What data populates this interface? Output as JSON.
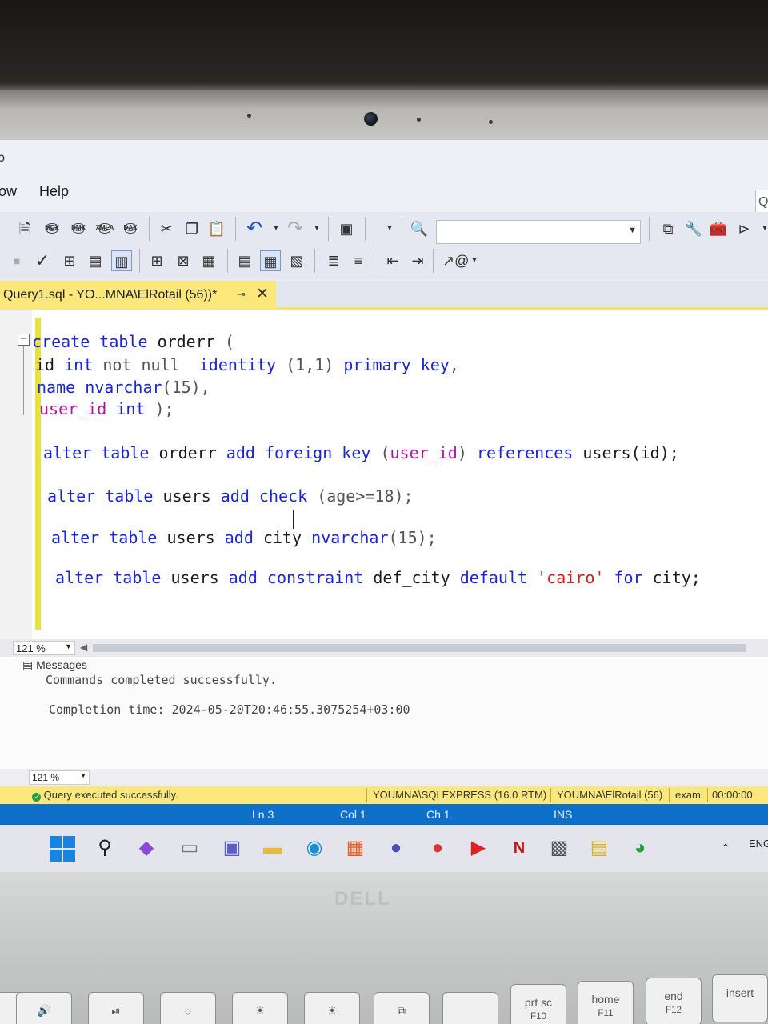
{
  "menu": {
    "partial_left": "ow",
    "help": "Help",
    "partial_top": "ɔ"
  },
  "toolbar1": {
    "icons": [
      "new-query-icon",
      "mdx-icon",
      "dmx-icon",
      "xmla-icon",
      "dax-icon",
      "cut-icon",
      "copy-icon",
      "paste-icon",
      "undo-icon",
      "redo-icon",
      "save-icon",
      "find-icon"
    ],
    "mdx": "MDX",
    "dmx": "DMX",
    "xmla": "XMLA",
    "dax": "DAX",
    "database_value": ""
  },
  "tab": {
    "title": "Query1.sql - YO...MNA\\ElRotail (56))*",
    "pin": "⊸",
    "close": "✕"
  },
  "code": {
    "l1_kw1": "create",
    "l1_kw2": "table",
    "l1_name": "orderr",
    "l1_paren": "(",
    "l2_a": "id",
    "l2_b": "int",
    "l2_c": "not null",
    "l2_d": "identity",
    "l2_e": "(1,1)",
    "l2_f": "primary key",
    "l2_g": ",",
    "l3_a": "name",
    "l3_b": "nvarchar",
    "l3_c": "(15),",
    "l4_a": "user_id",
    "l4_b": "int",
    "l4_c": ");",
    "l5_a": "alter table",
    "l5_b": "orderr",
    "l5_c": "add foreign key",
    "l5_d": "(",
    "l5_e": "user_id",
    "l5_f": ")",
    "l5_g": "references",
    "l5_h": "users(id);",
    "l6_a": "alter table",
    "l6_b": "users",
    "l6_c": "add check",
    "l6_d": "(age>=18);",
    "l7_a": "alter table",
    "l7_b": "users",
    "l7_c": "add",
    "l7_d": "city",
    "l7_e": "nvarchar",
    "l7_f": "(15);",
    "l8_a": "alter table",
    "l8_b": "users",
    "l8_c": "add constraint",
    "l8_d": "def_city",
    "l8_e": "default",
    "l8_f": "'cairo'",
    "l8_g": "for",
    "l8_h": "city;"
  },
  "editor": {
    "zoom": "121 %"
  },
  "messages": {
    "tab": "Messages",
    "line1": "Commands completed successfully.",
    "line2": "Completion time: 2024-05-20T20:46:55.3075254+03:00",
    "zoom": "121 %"
  },
  "status": {
    "query_result": "Query executed successfully.",
    "server": "YOUMNA\\SQLEXPRESS (16.0 RTM)",
    "login": "YOUMNA\\ElRotail (56)",
    "db": "exam",
    "elapsed": "00:00:00"
  },
  "position": {
    "ln": "Ln 3",
    "col": "Col 1",
    "ch": "Ch 1",
    "mode": "INS"
  },
  "taskbar": {
    "lang": "ENG"
  },
  "laptop": {
    "brand": "DELL",
    "keys": [
      "prt sc",
      "home",
      "end",
      "insert"
    ],
    "fkeys": [
      "F10",
      "F11",
      "F12"
    ]
  },
  "colors": {
    "keyword": "#1a25d6",
    "system_function": "#b0139d",
    "string": "#d1211e",
    "tab_highlight": "#fbe77a",
    "statusbar_blue": "#0e70c9"
  }
}
